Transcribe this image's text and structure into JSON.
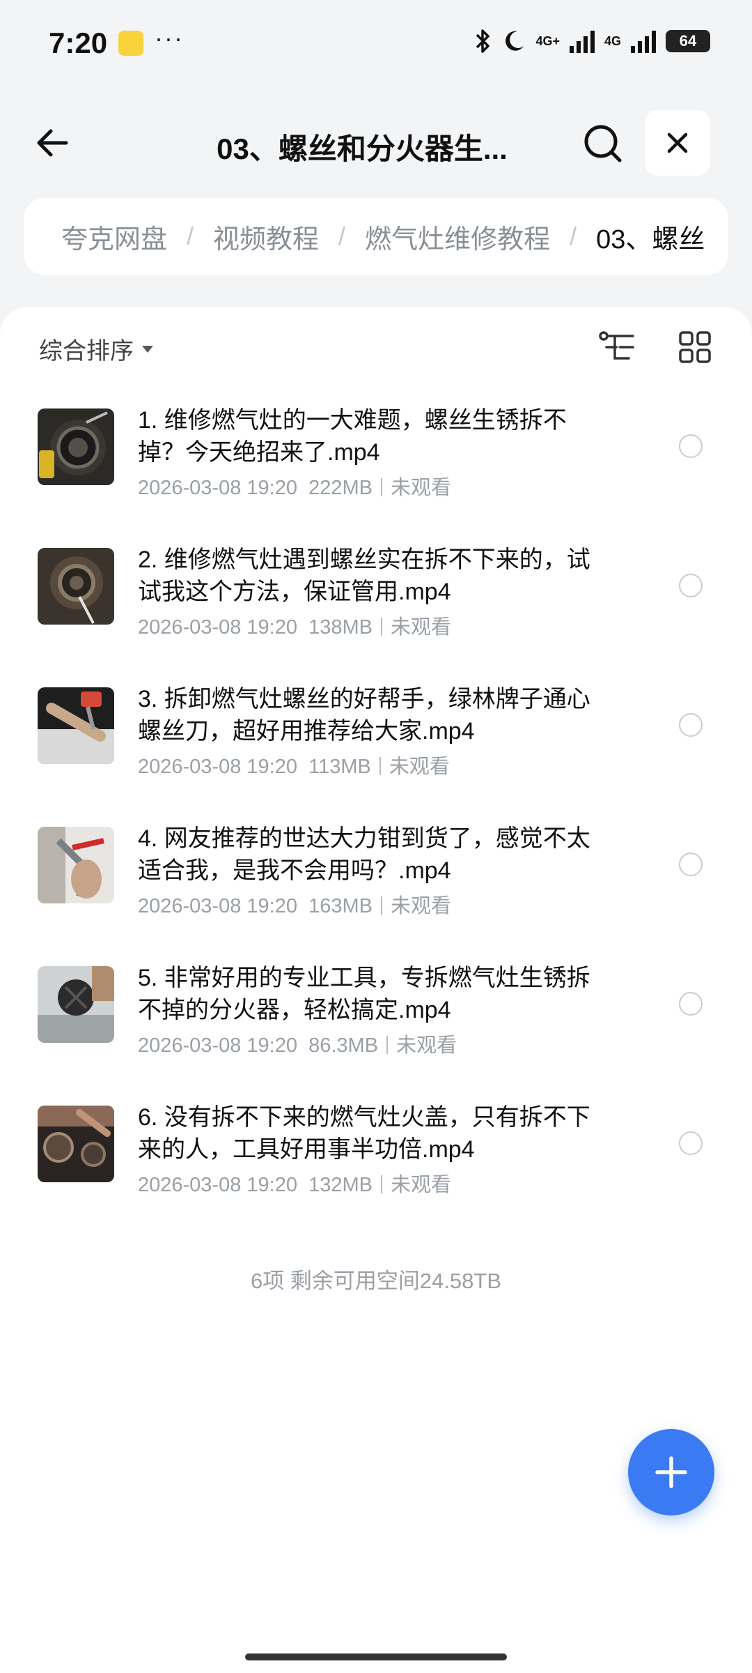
{
  "status_bar": {
    "time": "7:20",
    "more": "···",
    "net1": "4G+",
    "net2": "4G",
    "battery": "64"
  },
  "header": {
    "title": "03、螺丝和分火器生...",
    "back_icon": "arrow-left-icon",
    "search_icon": "search-icon",
    "close_icon": "close-icon"
  },
  "breadcrumb": {
    "items": [
      "夸克网盘",
      "视频教程",
      "燃气灶维修教程",
      "03、螺丝"
    ],
    "separator": "/"
  },
  "toolbar": {
    "sort_label": "综合排序",
    "tree_icon": "tree-view-icon",
    "grid_icon": "grid-view-icon"
  },
  "files": [
    {
      "name": "1. 维修燃气灶的一大难题，螺丝生锈拆不掉？今天绝招来了.mp4",
      "date": "2026-03-08 19:20",
      "size": "222MB",
      "status": "未观看"
    },
    {
      "name": "2. 维修燃气灶遇到螺丝实在拆不下来的，试试我这个方法，保证管用.mp4",
      "date": "2026-03-08 19:20",
      "size": "138MB",
      "status": "未观看"
    },
    {
      "name": "3. 拆卸燃气灶螺丝的好帮手，绿林牌子通心螺丝刀，超好用推荐给大家.mp4",
      "date": "2026-03-08 19:20",
      "size": "113MB",
      "status": "未观看"
    },
    {
      "name": "4. 网友推荐的世达大力钳到货了，感觉不太适合我，是我不会用吗？.mp4",
      "date": "2026-03-08 19:20",
      "size": "163MB",
      "status": "未观看"
    },
    {
      "name": "5. 非常好用的专业工具，专拆燃气灶生锈拆不掉的分火器，轻松搞定.mp4",
      "date": "2026-03-08 19:20",
      "size": "86.3MB",
      "status": "未观看"
    },
    {
      "name": "6. 没有拆不下来的燃气灶火盖，只有拆不下来的人，工具好用事半功倍.mp4",
      "date": "2026-03-08 19:20",
      "size": "132MB",
      "status": "未观看"
    }
  ],
  "footer": {
    "summary": "6项 剩余可用空间24.58TB"
  },
  "fab": {
    "icon": "plus-icon",
    "color": "#3a7af2"
  }
}
